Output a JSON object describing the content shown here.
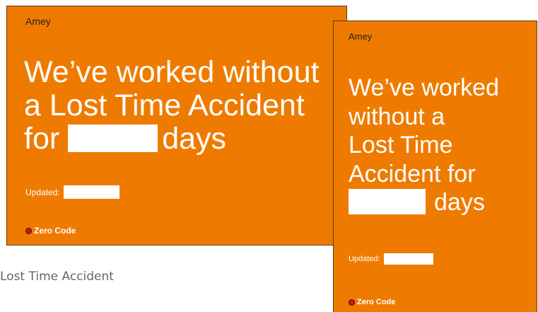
{
  "colors": {
    "sign_background": "#EE7B00",
    "brand_text": "#1F1F1F",
    "zero_code_dot": "#C41A1A",
    "caption_text": "#666666"
  },
  "landscape_sign": {
    "brand": "Amey",
    "headline_line1": "We’ve worked without",
    "headline_line2": "a Lost Time Accident",
    "headline_line3_start": "for",
    "headline_line3_end": "days",
    "updated_label": "Updated:",
    "footer_icon": "red-dot-icon",
    "footer_label": "Zero Code"
  },
  "portrait_sign": {
    "brand": "Amey",
    "headline_line1": "We’ve worked",
    "headline_line2": "without a",
    "headline_line3": "Lost Time",
    "headline_line4": "Accident for",
    "headline_line5_end": "days",
    "updated_label": "Updated:",
    "footer_icon": "red-dot-icon",
    "footer_label": "Zero Code"
  },
  "caption": "Lost Time Accident"
}
